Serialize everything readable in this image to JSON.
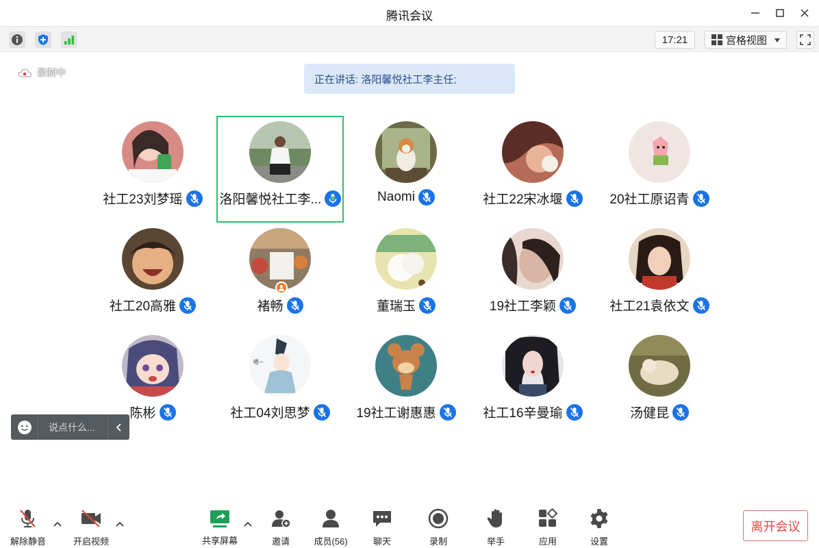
{
  "window": {
    "title": "腾讯会议"
  },
  "topbar": {
    "time": "17:21",
    "view_label": "宫格视图"
  },
  "recording": {
    "label": "录制中"
  },
  "speaking": {
    "text": "正在讲话: 洛阳馨悦社工李主任;"
  },
  "participants": [
    {
      "name": "社工23刘梦瑶",
      "mic": "muted",
      "avatar_color": "#c96a6a"
    },
    {
      "name": "洛阳馨悦社工李...",
      "mic": "speaking",
      "active": true,
      "avatar_color": "#6f8a63"
    },
    {
      "name": "Naomi",
      "mic": "muted",
      "avatar_color": "#8a7a4c"
    },
    {
      "name": "社工22宋冰堰",
      "mic": "muted",
      "avatar_color": "#c78a6d"
    },
    {
      "name": "20社工原诏青",
      "mic": "muted",
      "avatar_color": "#efe6e3"
    },
    {
      "name": "社工20高雅",
      "mic": "muted",
      "avatar_color": "#c09066"
    },
    {
      "name": "褚畅",
      "mic": "muted",
      "host": true,
      "avatar_color": "#8e7b64"
    },
    {
      "name": "董瑞玉",
      "mic": "muted",
      "avatar_color": "#d7dba8"
    },
    {
      "name": "19社工李颖",
      "mic": "muted",
      "avatar_color": "#b79d8f"
    },
    {
      "name": "社工21袁依文",
      "mic": "muted",
      "avatar_color": "#c24a3a"
    },
    {
      "name": "陈彬",
      "mic": "muted",
      "avatar_color": "#5d5f87"
    },
    {
      "name": "社工04刘思梦",
      "mic": "muted",
      "avatar_color": "#f2f4f6"
    },
    {
      "name": "19社工谢惠惠",
      "mic": "muted",
      "avatar_color": "#3f7f86"
    },
    {
      "name": "社工16辛曼瑜",
      "mic": "muted",
      "avatar_color": "#3d3a44"
    },
    {
      "name": "汤健昆",
      "mic": "muted",
      "avatar_color": "#7f7a4f"
    }
  ],
  "chat": {
    "placeholder": "说点什么..."
  },
  "toolbar": {
    "unmute": "解除静音",
    "video": "开启视频",
    "share": "共享屏幕",
    "invite": "邀请",
    "members": "成员(56)",
    "chat": "聊天",
    "record": "录制",
    "raise_hand": "举手",
    "apps": "应用",
    "settings": "设置",
    "leave": "离开会议"
  },
  "colors": {
    "accent": "#1a73e8",
    "active_border": "#2fbf6c",
    "leave": "#e0463f"
  }
}
